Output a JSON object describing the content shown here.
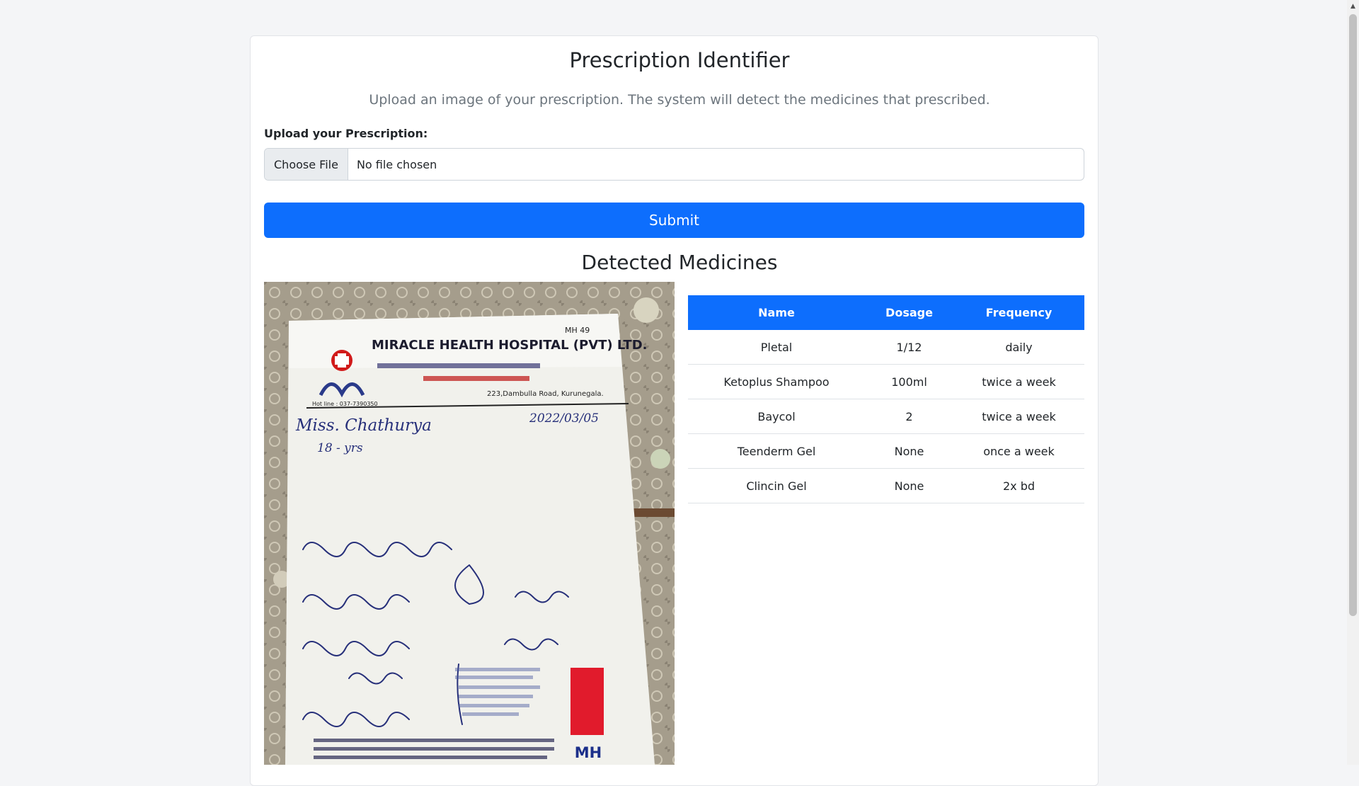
{
  "page": {
    "title": "Prescription Identifier",
    "lead": "Upload an image of your prescription. The system will detect the medicines that prescribed."
  },
  "upload": {
    "label": "Upload your Prescription:",
    "button_label": "Choose File",
    "status": "No file chosen"
  },
  "submit": {
    "label": "Submit"
  },
  "results": {
    "title": "Detected Medicines",
    "columns": [
      "Name",
      "Dosage",
      "Frequency"
    ],
    "rows": [
      {
        "name": "Pletal",
        "dosage": "1/12",
        "frequency": "daily"
      },
      {
        "name": "Ketoplus Shampoo",
        "dosage": "100ml",
        "frequency": "twice a week"
      },
      {
        "name": "Baycol",
        "dosage": "2",
        "frequency": "twice a week"
      },
      {
        "name": "Teenderm Gel",
        "dosage": "None",
        "frequency": "once a week"
      },
      {
        "name": "Clincin Gel",
        "dosage": "None",
        "frequency": "2x bd"
      }
    ]
  },
  "prescription_image": {
    "hospital_name": "MIRACLE HEALTH HOSPITAL (PVT) LTD.",
    "code": "MH 49",
    "address": "223,Dambulla Road, Kurunegala.",
    "hotline": "Hot line : 037-7390350",
    "patient": "Miss. Chathurya",
    "age": "18 - yrs",
    "date": "2022/03/05",
    "logo_text": "MH"
  },
  "colors": {
    "primary": "#0d6efd",
    "background": "#f4f5f7",
    "muted_text": "#6c757d"
  }
}
